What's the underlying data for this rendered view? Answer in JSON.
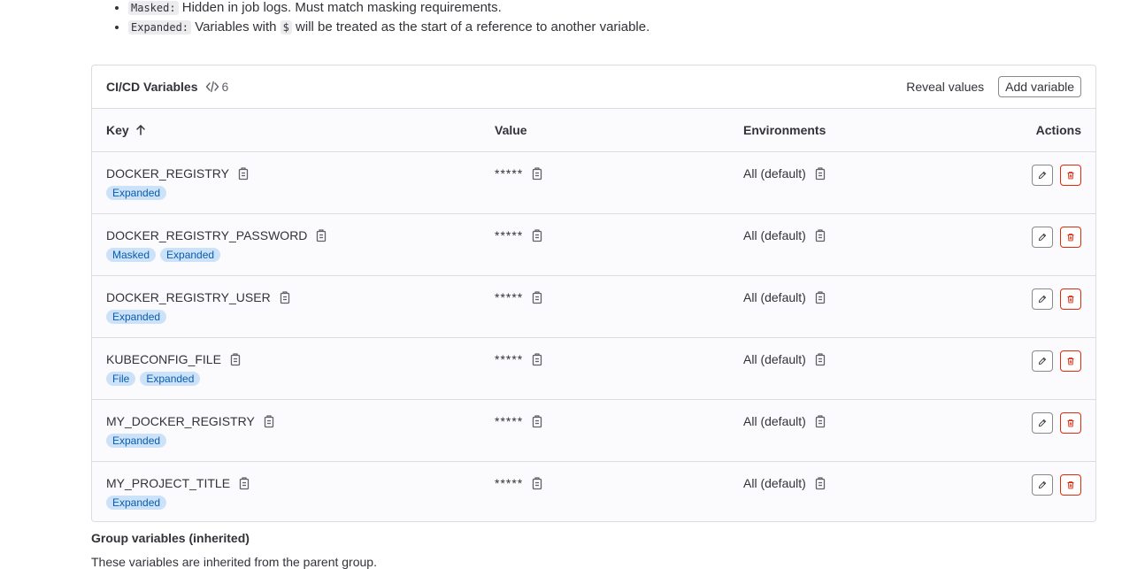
{
  "legend": [
    {
      "code": "Masked:",
      "text": " Hidden in job logs. Must match masking requirements."
    },
    {
      "code": "Expanded:",
      "text_before": " Variables with ",
      "inline_code": "$",
      "text_after": " will be treated as the start of a reference to another variable."
    }
  ],
  "card": {
    "title": "CI/CD Variables",
    "count": "6",
    "reveal_label": "Reveal values",
    "add_label": "Add variable"
  },
  "columns": {
    "key": "Key",
    "value": "Value",
    "environments": "Environments",
    "actions": "Actions"
  },
  "variables": [
    {
      "key": "DOCKER_REGISTRY",
      "value": "*****",
      "env": "All (default)",
      "badges": [
        "Expanded"
      ]
    },
    {
      "key": "DOCKER_REGISTRY_PASSWORD",
      "value": "*****",
      "env": "All (default)",
      "badges": [
        "Masked",
        "Expanded"
      ]
    },
    {
      "key": "DOCKER_REGISTRY_USER",
      "value": "*****",
      "env": "All (default)",
      "badges": [
        "Expanded"
      ]
    },
    {
      "key": "KUBECONFIG_FILE",
      "value": "*****",
      "env": "All (default)",
      "badges": [
        "File",
        "Expanded"
      ]
    },
    {
      "key": "MY_DOCKER_REGISTRY",
      "value": "*****",
      "env": "All (default)",
      "badges": [
        "Expanded"
      ]
    },
    {
      "key": "MY_PROJECT_TITLE",
      "value": "*****",
      "env": "All (default)",
      "badges": [
        "Expanded"
      ]
    }
  ],
  "group_section": {
    "title": "Group variables (inherited)",
    "description": "These variables are inherited from the parent group."
  },
  "colors": {
    "badge_bg": "#cbe2f9",
    "badge_text": "#0b5cad",
    "danger": "#dd2b0e"
  }
}
